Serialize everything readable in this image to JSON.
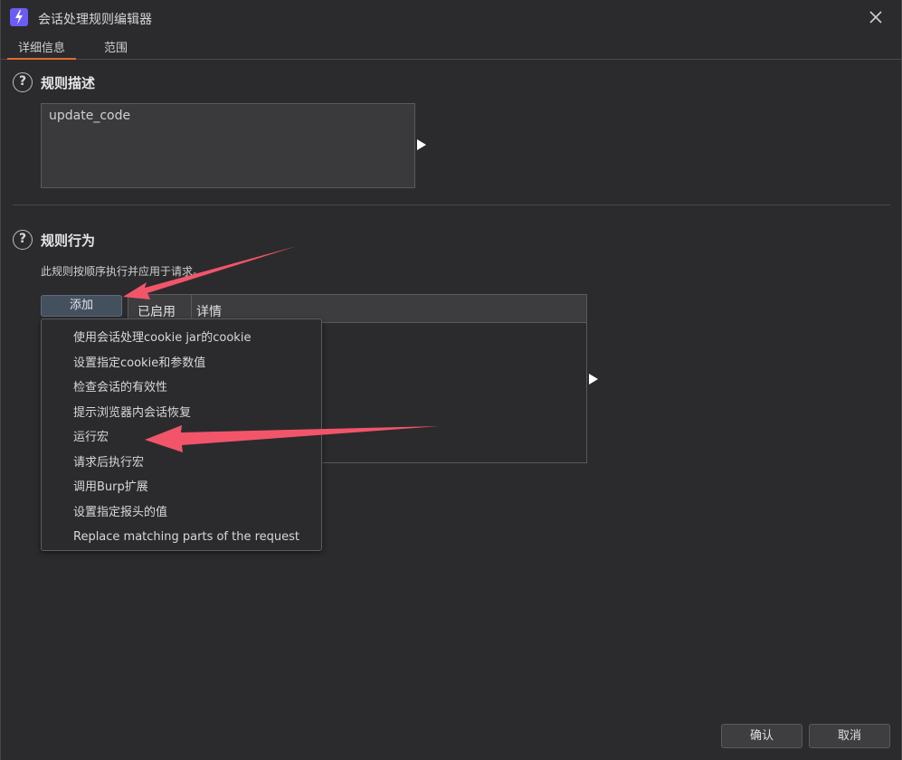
{
  "window": {
    "title": "会话处理规则编辑器",
    "close_icon": "close-icon"
  },
  "tabs": [
    {
      "label": "详细信息",
      "active": true
    },
    {
      "label": "范围",
      "active": false
    }
  ],
  "description_section": {
    "title": "规则描述",
    "help_icon": "?",
    "value": "update_code"
  },
  "behavior_section": {
    "title": "规则行为",
    "help_icon": "?",
    "description": "此规则按顺序执行并应用于请求。"
  },
  "add_button": {
    "label": "添加"
  },
  "table": {
    "columns": [
      "已启用",
      "详情"
    ],
    "rows": []
  },
  "menu": {
    "items": [
      "使用会话处理cookie jar的cookie",
      "设置指定cookie和参数值",
      "检查会话的有效性",
      "提示浏览器内会话恢复",
      "运行宏",
      "请求后执行宏",
      "调用Burp扩展",
      "设置指定报头的值",
      "Replace matching parts of the request"
    ]
  },
  "footer": {
    "ok_label": "确认",
    "cancel_label": "取消"
  },
  "colors": {
    "background": "#2b2b2d",
    "tab_accent": "#e06c2f",
    "annotation_arrow": "#f2556a",
    "app_icon": "#6b5cf6"
  }
}
